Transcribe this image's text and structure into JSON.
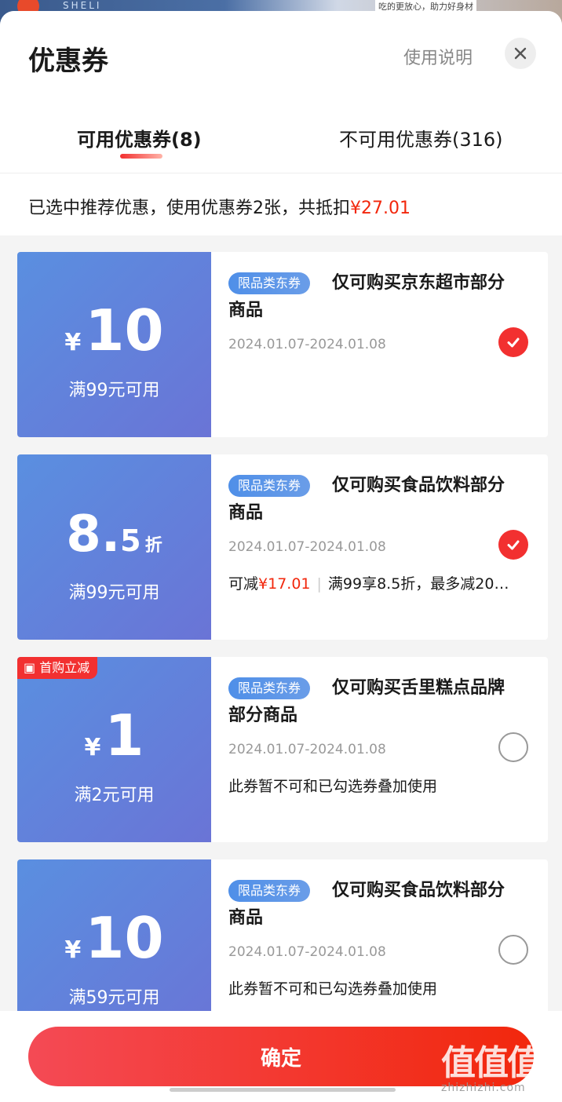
{
  "background_page": {
    "brand": "SHELI",
    "tagline": "吃的更放心，助力好身材"
  },
  "header": {
    "title": "优惠券",
    "help_link": "使用说明",
    "close_icon": "close-icon"
  },
  "tabs": [
    {
      "label": "可用优惠券(8)",
      "active": true
    },
    {
      "label": "不可用优惠券(316)",
      "active": false
    }
  ],
  "summary": {
    "text": "已选中推荐优惠，使用优惠券2张，共抵扣",
    "amount": "¥27.01"
  },
  "coupons": [
    {
      "currency": "¥",
      "value": "10",
      "condition": "满99元可用",
      "tag": "限品类东券",
      "description": "仅可购买京东超市部分商品",
      "date": "2024.01.07-2024.01.08",
      "selected": true
    },
    {
      "value_int": "8.",
      "value_dec": "5",
      "unit": "折",
      "condition": "满99元可用",
      "tag": "限品类东券",
      "description": "仅可购买食品饮料部分商品",
      "date": "2024.01.07-2024.01.08",
      "extra_prefix": "可减",
      "extra_amount": "¥17.01",
      "extra_rule": "满99享8.5折，最多减20…",
      "selected": true
    },
    {
      "badge": "首购立减",
      "currency": "¥",
      "value": "1",
      "condition": "满2元可用",
      "tag": "限品类东券",
      "description": "仅可购买舌里糕点品牌部分商品",
      "date": "2024.01.07-2024.01.08",
      "note": "此券暂不可和已勾选券叠加使用",
      "selected": false
    },
    {
      "currency": "¥",
      "value": "10",
      "condition": "满59元可用",
      "tag": "限品类东券",
      "description": "仅可购买食品饮料部分商品",
      "date": "2024.01.07-2024.01.08",
      "note": "此券暂不可和已勾选券叠加使用",
      "selected": false
    }
  ],
  "footer": {
    "confirm_label": "确定"
  },
  "watermark": {
    "big": "值值值",
    "site": "zhizhizhi.com"
  },
  "colors": {
    "accent_red": "#f2270c",
    "coupon_blue": "#5a8fe0"
  }
}
